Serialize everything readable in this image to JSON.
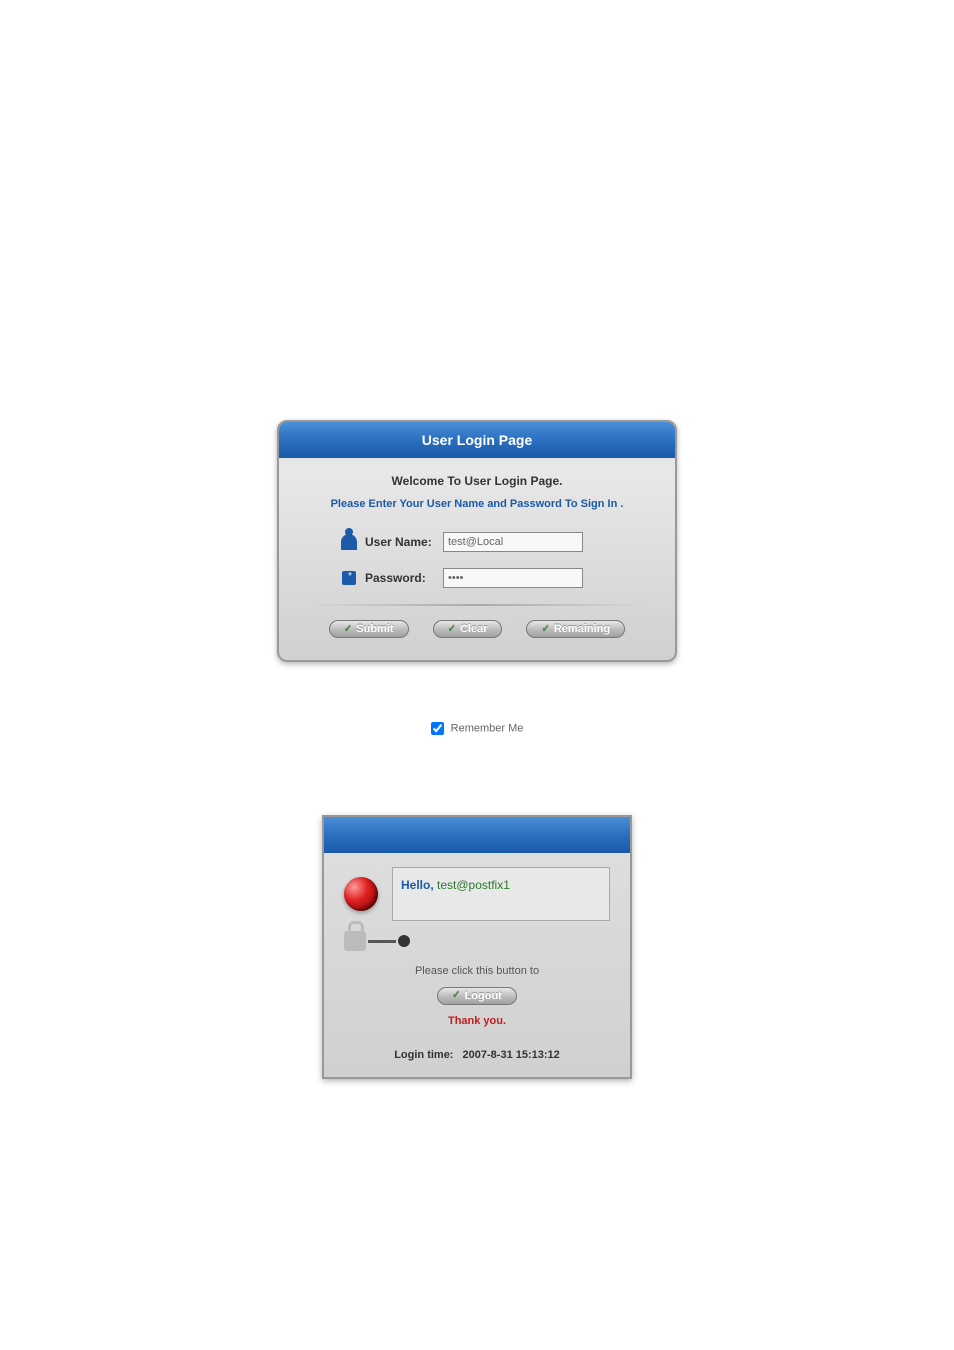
{
  "login": {
    "title": "User Login Page",
    "welcome": "Welcome To User Login Page.",
    "instruction": "Please Enter Your User Name and Password To Sign In .",
    "username_label": "User Name:",
    "username_value": "test@Local",
    "password_label": "Password:",
    "password_value": "••••",
    "buttons": {
      "submit": "Submit",
      "clear": "Clear",
      "remaining": "Remaining"
    },
    "remember_label": "Remember Me",
    "remember_checked": true
  },
  "logout": {
    "hello_label": "Hello,",
    "username": "test@postfix1",
    "instruction": "Please click this button to",
    "logout_button": "Logout",
    "thank_you": "Thank you.",
    "login_time_label": "Login time:",
    "login_time_value": "2007-8-31 15:13:12"
  }
}
